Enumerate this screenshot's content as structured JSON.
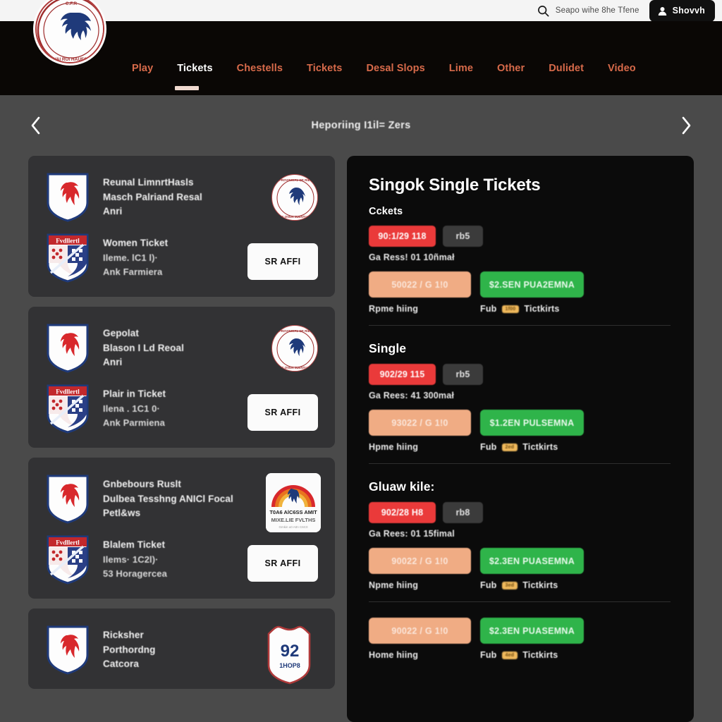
{
  "topbar": {
    "logo_name": "club-crest-logo",
    "search": {
      "icon": "search-icon",
      "placeholder": "Seapo wihe 8he Tfene",
      "value": ""
    },
    "signin": {
      "icon": "user-icon",
      "label": "Shovvh"
    }
  },
  "nav": {
    "items": [
      {
        "label": "Play",
        "active": false
      },
      {
        "label": "Tickets",
        "active": true
      },
      {
        "label": "Chestells",
        "active": false
      },
      {
        "label": "Tickets",
        "active": false
      },
      {
        "label": "Desal Slops",
        "active": false
      },
      {
        "label": "Lime",
        "active": false
      },
      {
        "label": "Other",
        "active": false
      },
      {
        "label": "Dulidet",
        "active": false
      },
      {
        "label": "Video",
        "active": false
      }
    ]
  },
  "carousel": {
    "title": "Heporiing I1il= Zers",
    "prev_icon": "chevron-left-icon",
    "next_icon": "chevron-right-icon"
  },
  "matches": [
    {
      "fixture": {
        "crest": "horse-shield-crest",
        "title": "Reunal LimnrtHasls",
        "line2": "Masch Palriand Resal",
        "line3": "Anri",
        "badge_type": "round",
        "badge_name": "round-competition-badge"
      },
      "ticket": {
        "crest": "heraldic-shield-crest",
        "title": "Women Ticket",
        "line2": "Ileme. lC1 l)·",
        "line3": "Ank Farmiera",
        "action_label": "SR AFFI"
      }
    },
    {
      "fixture": {
        "crest": "horse-shield-crest",
        "title": "Gepolat",
        "line2": "Blason I Ld Reoal",
        "line3": "Anri",
        "badge_type": "round",
        "badge_name": "round-competition-badge"
      },
      "ticket": {
        "crest": "heraldic-shield-crest",
        "title": "Plair in Ticket",
        "line2": "Ilena . 1C1 0·",
        "line3": "Ank Parmiena",
        "action_label": "SR AFFI"
      }
    },
    {
      "fixture": {
        "crest": "horse-shield-crest",
        "title": "Gnbebours Ruslt",
        "line2": "Dulbea Tesshng ANICl Focal",
        "line3": "Petl&ws",
        "badge_type": "arch",
        "badge_name": "arch-rainbow-badge",
        "badge_line1": "T0A6 AlC6SS AMIT",
        "badge_line2": "MIXE.LIE FVLTHS",
        "badge_line3": "Gmkin u0 A0n  C6C0"
      },
      "ticket": {
        "crest": "heraldic-shield-crest",
        "title": "Blalem Ticket",
        "line2": "Ilems· 1C2l)·",
        "line3": "53 Horagercea",
        "action_label": "SR AFFI"
      }
    },
    {
      "fixture": {
        "crest": "horse-shield-crest",
        "title": "Ricksher",
        "line2": "Porthordng",
        "line3": "Catcora",
        "badge_type": "shield",
        "badge_name": "number-shield-badge",
        "badge_number": "92",
        "badge_sub": "1HOP8"
      }
    }
  ],
  "tickets_panel": {
    "heading": "Singok Single Tickets",
    "sections": [
      {
        "title": "Cckets",
        "title_size": "small",
        "price_pill": "90:1/29 118",
        "qty_pill": "rb5",
        "meta": "Ga Ress! 01 10ñmał",
        "primary_btn": "50022 / G 1!0",
        "secondary_btn": "$2.SEN PUA2EMNA",
        "caption_left": "Rpme hiing",
        "caption_right_pre": "Fub",
        "caption_tag": "1f00",
        "caption_right_post": "Tictkirts"
      },
      {
        "title": "Single",
        "title_size": "normal",
        "price_pill": "902/29 115",
        "qty_pill": "rb5",
        "meta": "Ga Rees: 41 300mał",
        "primary_btn": "93022 / G 1!0",
        "secondary_btn": "$1.2EN PULSEMNA",
        "caption_left": "Hpme hiing",
        "caption_right_pre": "Fub",
        "caption_tag": "2ed",
        "caption_right_post": "Tictkirts"
      },
      {
        "title": "Gluaw kile:",
        "title_size": "normal",
        "price_pill": "902/28 H8",
        "qty_pill": "rb8",
        "meta": "Ga Rees: 01 15fimal",
        "primary_btn": "90022 / G 1!0",
        "secondary_btn": "$2.3EN PUASEMNA",
        "caption_left": "Npme hiing",
        "caption_right_pre": "Fub",
        "caption_tag": "3ed",
        "caption_right_post": "Tictkirts"
      },
      {
        "title": "",
        "title_size": "normal",
        "price_pill": "",
        "qty_pill": "",
        "meta": "",
        "primary_btn": "90022 / G 1!0",
        "secondary_btn": "$2.3EN PUASEMNA",
        "caption_left": "Home hiing",
        "caption_right_pre": "Fub",
        "caption_tag": "4ed",
        "caption_right_post": "Tictkirts"
      }
    ]
  },
  "colors": {
    "nav_link": "#d76a4a",
    "accent_red": "#ea3a3a",
    "accent_green": "#2fb44a",
    "accent_peach": "#f0ac84",
    "panel_bg": "#0b0b0b",
    "card_bg": "#323234",
    "stage_bg": "#4a4a4a"
  }
}
